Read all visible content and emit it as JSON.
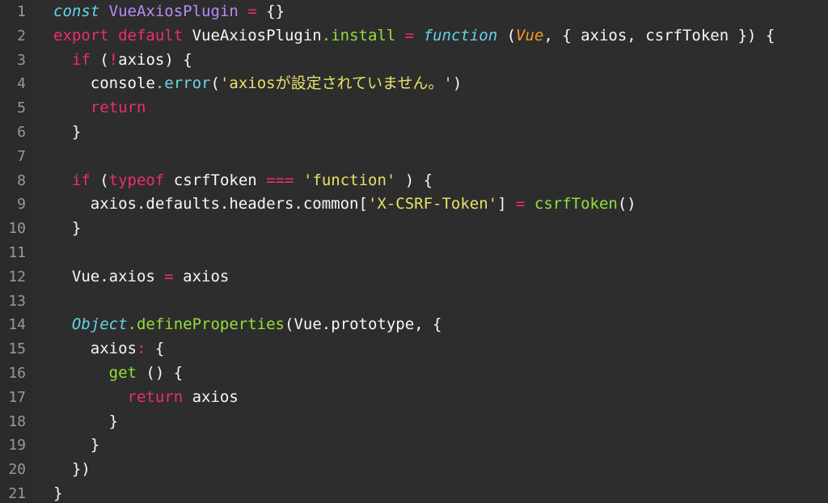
{
  "editor": {
    "type": "code-viewer",
    "language": "javascript",
    "theme": "dark",
    "background_color": "#2d2d2d",
    "gutter_background_color": "#2b2b2b",
    "gutter_text_color": "#999999",
    "default_text_color": "#f8f8f2",
    "font_size_px": 19,
    "line_height_px": 29.8,
    "first_visible_line": 1,
    "last_visible_line": 21,
    "palette": {
      "keyword_pink": "#ed2e6a",
      "keyword_italic_cyan": "#5fd7e8",
      "type_purple": "#b48ef7",
      "function_green": "#93e03a",
      "property_blue": "#6fd3e8",
      "string_yellow": "#e6e267",
      "param_orange": "#f59a23",
      "plain_white": "#f8f8f2"
    }
  },
  "lines": [
    {
      "number": "1",
      "text": "const VueAxiosPlugin = {}",
      "tokens": [
        {
          "text": "const",
          "style": "t-kw-it"
        },
        {
          "text": " ",
          "style": "t-plain"
        },
        {
          "text": "VueAxiosPlugin",
          "style": "t-type"
        },
        {
          "text": " ",
          "style": "t-plain"
        },
        {
          "text": "=",
          "style": "t-op"
        },
        {
          "text": " {}",
          "style": "t-plain"
        }
      ]
    },
    {
      "number": "2",
      "text": "export default VueAxiosPlugin.install = function (Vue, { axios, csrfToken }) {",
      "tokens": [
        {
          "text": "export default",
          "style": "t-kw"
        },
        {
          "text": " VueAxiosPlugin",
          "style": "t-plain"
        },
        {
          "text": ".install",
          "style": "t-fn"
        },
        {
          "text": " ",
          "style": "t-plain"
        },
        {
          "text": "=",
          "style": "t-op"
        },
        {
          "text": " ",
          "style": "t-plain"
        },
        {
          "text": "function",
          "style": "t-kw-it"
        },
        {
          "text": " (",
          "style": "t-plain"
        },
        {
          "text": "Vue",
          "style": "t-param"
        },
        {
          "text": ", { axios, csrfToken }) {",
          "style": "t-plain"
        }
      ]
    },
    {
      "number": "3",
      "text": "  if (!axios) {",
      "tokens": [
        {
          "text": "  ",
          "style": "t-plain"
        },
        {
          "text": "if",
          "style": "t-kw"
        },
        {
          "text": " (",
          "style": "t-plain"
        },
        {
          "text": "!",
          "style": "t-op"
        },
        {
          "text": "axios) {",
          "style": "t-plain"
        }
      ]
    },
    {
      "number": "4",
      "text": "    console.error('axiosが設定されていません。')",
      "tokens": [
        {
          "text": "    console",
          "style": "t-plain"
        },
        {
          "text": ".error",
          "style": "t-prop"
        },
        {
          "text": "(",
          "style": "t-plain"
        },
        {
          "text": "'axiosが設定されていません。'",
          "style": "t-str"
        },
        {
          "text": ")",
          "style": "t-plain"
        }
      ]
    },
    {
      "number": "5",
      "text": "    return",
      "tokens": [
        {
          "text": "    ",
          "style": "t-plain"
        },
        {
          "text": "return",
          "style": "t-kw"
        }
      ]
    },
    {
      "number": "6",
      "text": "  }",
      "tokens": [
        {
          "text": "  }",
          "style": "t-plain"
        }
      ]
    },
    {
      "number": "7",
      "text": "",
      "tokens": []
    },
    {
      "number": "8",
      "text": "  if (typeof csrfToken === 'function' ) {",
      "tokens": [
        {
          "text": "  ",
          "style": "t-plain"
        },
        {
          "text": "if",
          "style": "t-kw"
        },
        {
          "text": " (",
          "style": "t-plain"
        },
        {
          "text": "typeof",
          "style": "t-kw"
        },
        {
          "text": " csrfToken ",
          "style": "t-plain"
        },
        {
          "text": "===",
          "style": "t-op"
        },
        {
          "text": " ",
          "style": "t-plain"
        },
        {
          "text": "'function'",
          "style": "t-str"
        },
        {
          "text": " ) {",
          "style": "t-plain"
        }
      ]
    },
    {
      "number": "9",
      "text": "    axios.defaults.headers.common['X-CSRF-Token'] = csrfToken()",
      "tokens": [
        {
          "text": "    axios.defaults.headers.common[",
          "style": "t-plain"
        },
        {
          "text": "'X-CSRF-Token'",
          "style": "t-str"
        },
        {
          "text": "] ",
          "style": "t-plain"
        },
        {
          "text": "=",
          "style": "t-op"
        },
        {
          "text": " ",
          "style": "t-plain"
        },
        {
          "text": "csrfToken",
          "style": "t-fn"
        },
        {
          "text": "()",
          "style": "t-plain"
        }
      ]
    },
    {
      "number": "10",
      "text": "  }",
      "tokens": [
        {
          "text": "  }",
          "style": "t-plain"
        }
      ]
    },
    {
      "number": "11",
      "text": "",
      "tokens": []
    },
    {
      "number": "12",
      "text": "  Vue.axios = axios",
      "tokens": [
        {
          "text": "  Vue.axios ",
          "style": "t-plain"
        },
        {
          "text": "=",
          "style": "t-op"
        },
        {
          "text": " axios",
          "style": "t-plain"
        }
      ]
    },
    {
      "number": "13",
      "text": "",
      "tokens": []
    },
    {
      "number": "14",
      "text": "  Object.defineProperties(Vue.prototype, {",
      "tokens": [
        {
          "text": "  ",
          "style": "t-plain"
        },
        {
          "text": "Object",
          "style": "t-kw-it"
        },
        {
          "text": ".defineProperties",
          "style": "t-fn"
        },
        {
          "text": "(Vue.prototype, {",
          "style": "t-plain"
        }
      ]
    },
    {
      "number": "15",
      "text": "    axios: {",
      "tokens": [
        {
          "text": "    axios",
          "style": "t-plain"
        },
        {
          "text": ":",
          "style": "t-op"
        },
        {
          "text": " {",
          "style": "t-plain"
        }
      ]
    },
    {
      "number": "16",
      "text": "      get () {",
      "tokens": [
        {
          "text": "      ",
          "style": "t-plain"
        },
        {
          "text": "get",
          "style": "t-fn"
        },
        {
          "text": " () {",
          "style": "t-plain"
        }
      ]
    },
    {
      "number": "17",
      "text": "        return axios",
      "tokens": [
        {
          "text": "        ",
          "style": "t-plain"
        },
        {
          "text": "return",
          "style": "t-kw"
        },
        {
          "text": " axios",
          "style": "t-plain"
        }
      ]
    },
    {
      "number": "18",
      "text": "      }",
      "tokens": [
        {
          "text": "      }",
          "style": "t-plain"
        }
      ]
    },
    {
      "number": "19",
      "text": "    }",
      "tokens": [
        {
          "text": "    }",
          "style": "t-plain"
        }
      ]
    },
    {
      "number": "20",
      "text": "  })",
      "tokens": [
        {
          "text": "  })",
          "style": "t-plain"
        }
      ]
    },
    {
      "number": "21",
      "text": "}",
      "tokens": [
        {
          "text": "}",
          "style": "t-plain"
        }
      ]
    }
  ]
}
